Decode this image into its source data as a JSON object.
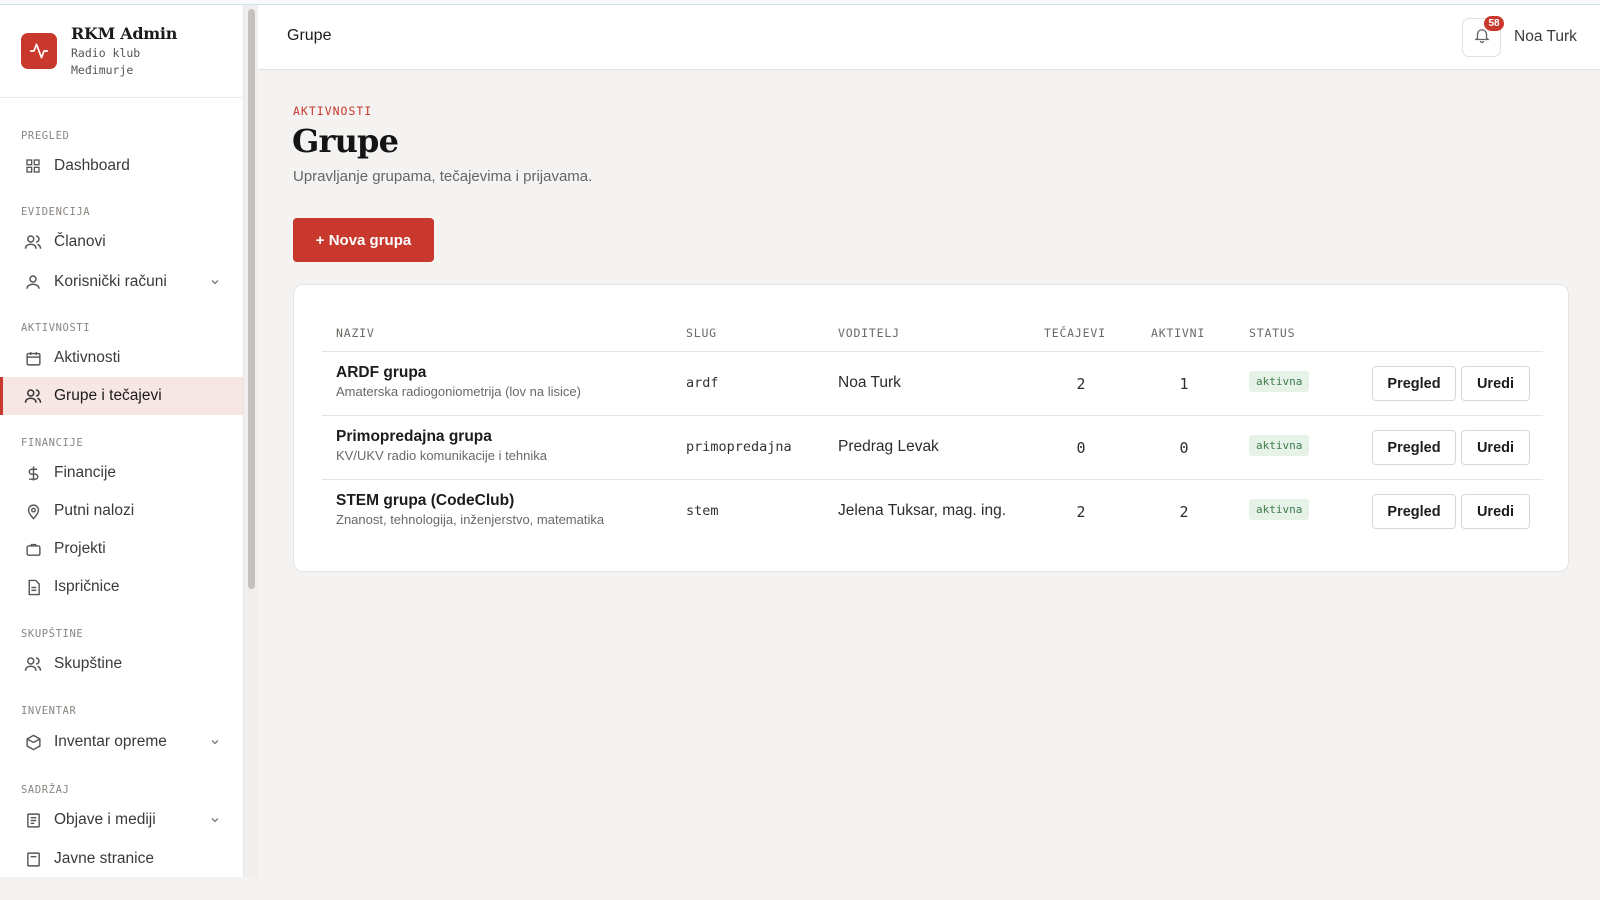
{
  "brand": {
    "title": "RKM Admin",
    "subtitle_line1": "Radio klub",
    "subtitle_line2": "Međimurje",
    "logo_icon": "activity-pulse-icon"
  },
  "sidebar": {
    "sections": {
      "pregled": "PREGLED",
      "evidencija": "EVIDENCIJA",
      "aktivnosti": "AKTIVNOSTI",
      "financije": "FINANCIJE",
      "skupstine": "SKUPŠTINE",
      "inventar": "INVENTAR",
      "sadrzaj": "SADRŽAJ"
    },
    "items": {
      "dashboard": "Dashboard",
      "clanovi": "Članovi",
      "korisnicki_racuni": "Korisnički računi",
      "aktivnosti": "Aktivnosti",
      "grupe": "Grupe i tečajevi",
      "financije": "Financije",
      "putni_nalozi": "Putni nalozi",
      "projekti": "Projekti",
      "ispricnice": "Ispričnice",
      "skupstine": "Skupštine",
      "inventar_opreme": "Inventar opreme",
      "objave_i_mediji": "Objave i mediji",
      "javne_stranice": "Javne stranice"
    },
    "active_item": "grupe"
  },
  "header": {
    "title": "Grupe",
    "notification_count": "58",
    "user_name": "Noa Turk"
  },
  "page": {
    "eyebrow": "AKTIVNOSTI",
    "title": "Grupe",
    "subtitle": "Upravljanje grupama, tečajevima i prijavama.",
    "new_button": "+ Nova grupa"
  },
  "table": {
    "columns": {
      "naziv": "NAZIV",
      "slug": "SLUG",
      "voditelj": "VODITELJ",
      "tecajevi": "TEČAJEVI",
      "aktivni": "AKTIVNI",
      "status": "STATUS"
    },
    "rows": [
      {
        "name": "ARDF grupa",
        "description": "Amaterska radiogoniometrija (lov na lisice)",
        "slug": "ardf",
        "leader": "Noa Turk",
        "courses": "2",
        "active": "1",
        "status": "aktivna",
        "view_label": "Pregled",
        "edit_label": "Uredi"
      },
      {
        "name": "Primopredajna grupa",
        "description": "KV/UKV radio komunikacije i tehnika",
        "slug": "primopredajna",
        "leader": "Predrag Levak",
        "courses": "0",
        "active": "0",
        "status": "aktivna",
        "view_label": "Pregled",
        "edit_label": "Uredi"
      },
      {
        "name": "STEM grupa (CodeClub)",
        "description": "Znanost, tehnologija, inženjerstvo, matematika",
        "slug": "stem",
        "leader": "Jelena Tuksar, mag. ing.",
        "courses": "2",
        "active": "2",
        "status": "aktivna",
        "view_label": "Pregled",
        "edit_label": "Uredi"
      }
    ]
  },
  "colors": {
    "accent": "#c9382c",
    "active_bg": "#f6e6e4",
    "status_bg": "#e6f2e8",
    "status_text": "#3e7a4c"
  }
}
